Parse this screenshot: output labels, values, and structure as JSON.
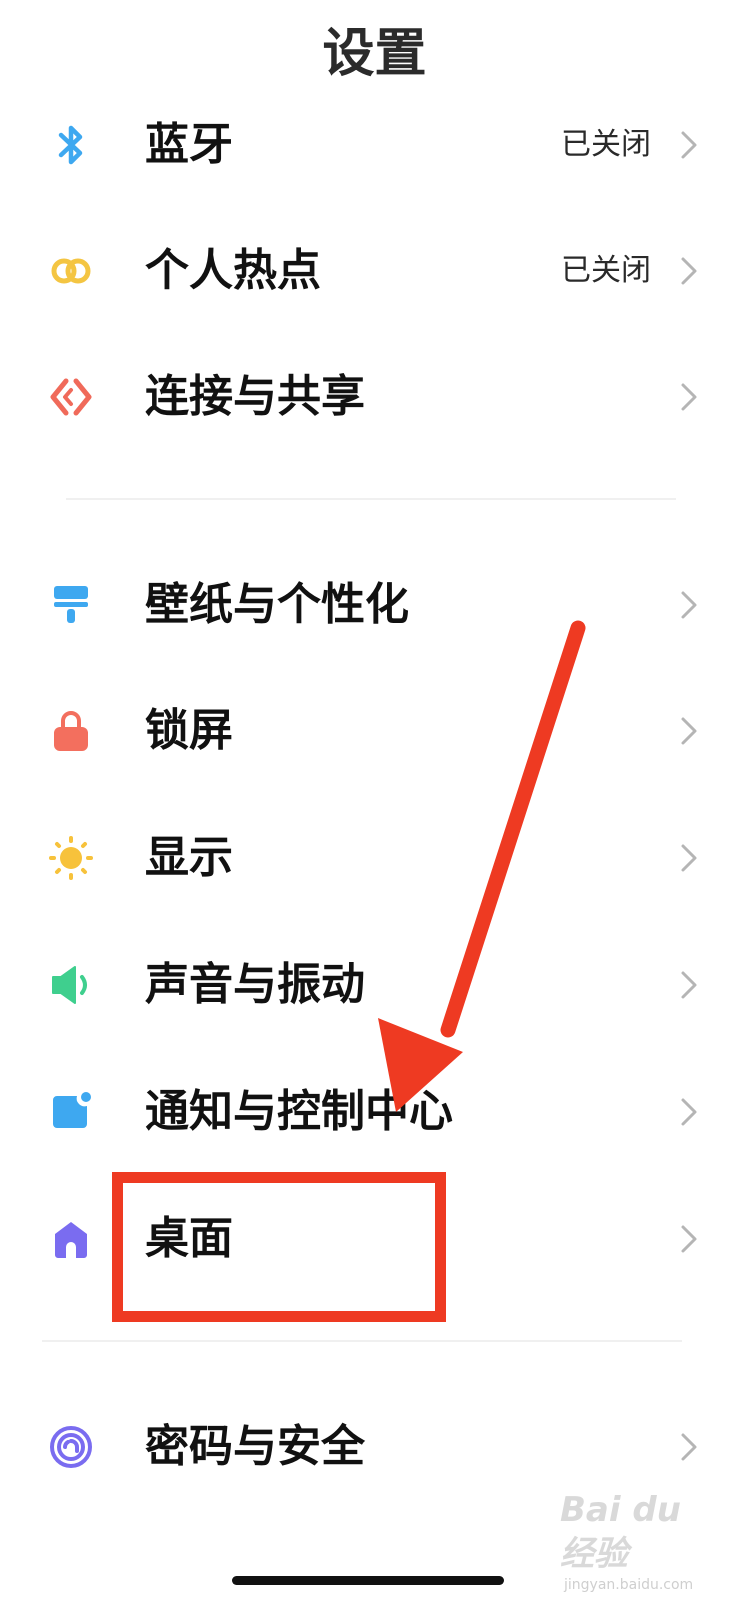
{
  "header": {
    "title": "设置"
  },
  "groups": [
    {
      "items": [
        {
          "label": "蓝牙",
          "status": "已关闭",
          "icon": "bluetooth-icon"
        },
        {
          "label": "个人热点",
          "status": "已关闭",
          "icon": "hotspot-icon"
        },
        {
          "label": "连接与共享",
          "status": "",
          "icon": "connection-share-icon"
        }
      ]
    },
    {
      "items": [
        {
          "label": "壁纸与个性化",
          "status": "",
          "icon": "wallpaper-icon"
        },
        {
          "label": "锁屏",
          "status": "",
          "icon": "lock-icon"
        },
        {
          "label": "显示",
          "status": "",
          "icon": "sun-icon"
        },
        {
          "label": "声音与振动",
          "status": "",
          "icon": "speaker-icon"
        },
        {
          "label": "通知与控制中心",
          "status": "",
          "icon": "notification-icon"
        },
        {
          "label": "桌面",
          "status": "",
          "icon": "home-icon"
        }
      ]
    },
    {
      "items": [
        {
          "label": "密码与安全",
          "status": "",
          "icon": "fingerprint-icon"
        }
      ]
    }
  ],
  "colors": {
    "bluetooth": "#3ea8f0",
    "hotspot": "#f4c542",
    "connection": "#f06a5a",
    "wallpaper": "#3ea8f0",
    "lock": "#f36f5e",
    "sun": "#f7c23b",
    "speaker": "#3fcf8e",
    "notification": "#3ea8f0",
    "home": "#7a6cf0",
    "fingerprint": "#7a6cf0",
    "annotation": "#ee3a22"
  },
  "watermark": {
    "brand": "Bai du 经验",
    "url": "jingyan.baidu.com"
  }
}
